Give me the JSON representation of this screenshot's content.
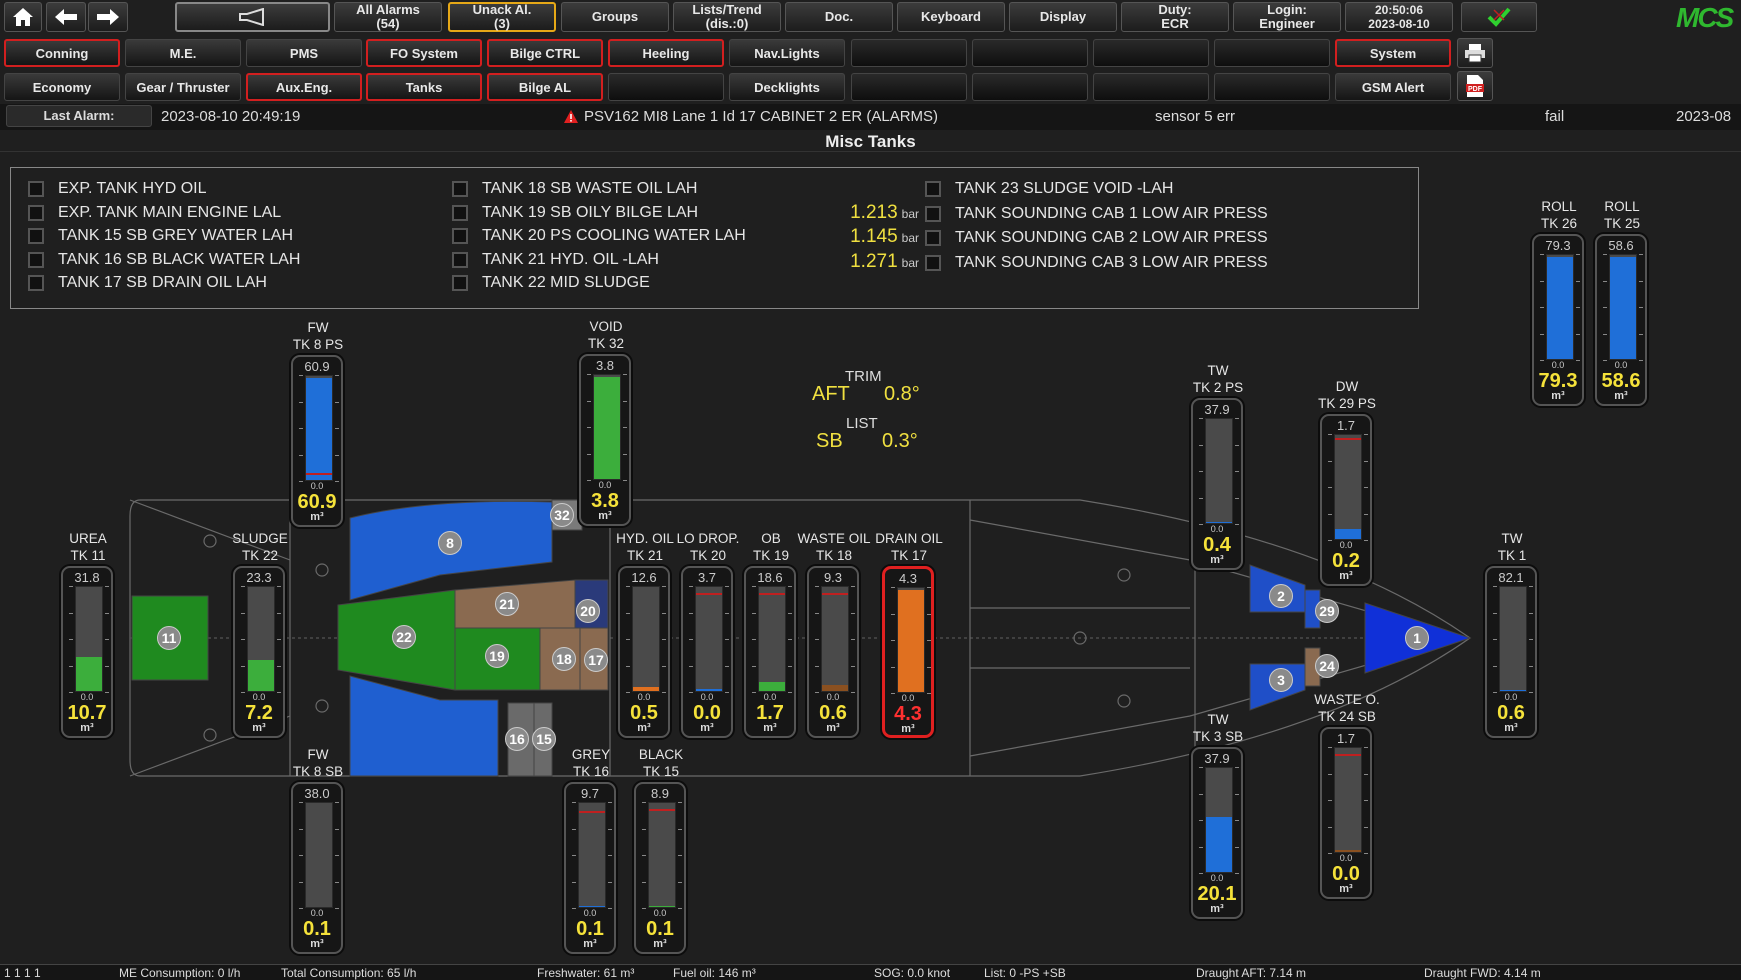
{
  "toolbar": {
    "all_alarms": [
      "All Alarms",
      "(54)"
    ],
    "unack": [
      "Unack Al.",
      "(3)"
    ],
    "groups": "Groups",
    "lists": [
      "Lists/Trend",
      "(dis.:0)"
    ],
    "doc": "Doc.",
    "keyboard": "Keyboard",
    "display": "Display",
    "duty": [
      "Duty:",
      "ECR"
    ],
    "login": [
      "Login:",
      "Engineer"
    ],
    "time": [
      "20:50:06",
      "2023-08-10"
    ],
    "logo": "MCS"
  },
  "nav_row1": [
    "Conning",
    "M.E.",
    "PMS",
    "FO System",
    "Bilge CTRL",
    "Heeling",
    "Nav.Lights",
    "",
    "",
    "",
    "",
    "System"
  ],
  "nav_row2": [
    "Economy",
    "Gear / Thruster",
    "Aux.Eng.",
    "Tanks",
    "Bilge AL",
    "",
    "Decklights",
    "",
    "",
    "",
    "",
    "GSM Alert"
  ],
  "alarm": {
    "label": "Last Alarm:",
    "time": "2023-08-10 20:49:19",
    "text": "PSV162 MI8 Lane  1 Id 17 CABINET 2 ER (ALARMS)",
    "desc": "sensor 5 err",
    "state": "fail",
    "date_cut": "2023-08"
  },
  "page_title": "Misc Tanks",
  "alarm_list_col1": [
    "EXP. TANK HYD OIL",
    "EXP. TANK MAIN ENGINE LAL",
    "TANK 15 SB GREY WATER LAH",
    "TANK 16 SB BLACK WATER LAH",
    "TANK 17 SB DRAIN OIL LAH"
  ],
  "alarm_list_col2": [
    "TANK 18 SB WASTE OIL LAH",
    "TANK 19 SB OILY BILGE LAH",
    "TANK 20 PS COOLING WATER LAH",
    "TANK 21 HYD. OIL -LAH",
    "TANK 22 MID SLUDGE"
  ],
  "alarm_list_col3": [
    {
      "value": "",
      "unit": "",
      "label": "TANK 23 SLUDGE VOID -LAH"
    },
    {
      "value": "1.213",
      "unit": "bar",
      "label": "TANK SOUNDING CAB 1 LOW AIR PRESS"
    },
    {
      "value": "1.145",
      "unit": "bar",
      "label": "TANK SOUNDING CAB 2 LOW AIR PRESS"
    },
    {
      "value": "1.271",
      "unit": "bar",
      "label": "TANK SOUNDING CAB 3 LOW AIR PRESS"
    }
  ],
  "trim": {
    "trim_label": "TRIM",
    "trim_dir": "AFT",
    "trim_val": "0.8°",
    "list_label": "LIST",
    "list_dir": "SB",
    "list_val": "0.3°"
  },
  "tanks": [
    {
      "name": [
        "FW",
        "TK 8 PS"
      ],
      "max": "60.9",
      "min": "0.0",
      "value": "60.9",
      "fraction": 0.98,
      "color": "#1f6fd8",
      "mark": 0.05
    },
    {
      "name": [
        "VOID",
        "TK 32"
      ],
      "max": "3.8",
      "min": "0.0",
      "value": "3.8",
      "fraction": 0.98,
      "color": "#3cae3c"
    },
    {
      "name": [
        "TW",
        "TK 2 PS"
      ],
      "max": "37.9",
      "min": "0.0",
      "value": "0.4",
      "fraction": 0.01,
      "color": "#1f6fd8"
    },
    {
      "name": [
        "DW",
        "TK 29 PS"
      ],
      "max": "1.7",
      "min": "0.0",
      "value": "0.2",
      "fraction": 0.1,
      "color": "#1f6fd8",
      "mark": 0.95
    },
    {
      "name": [
        "ROLL",
        "TK 26"
      ],
      "max": "79.3",
      "min": "0.0",
      "value": "79.3",
      "fraction": 0.98,
      "color": "#1f6fd8"
    },
    {
      "name": [
        "ROLL",
        "TK 25"
      ],
      "max": "58.6",
      "min": "0.0",
      "value": "58.6",
      "fraction": 0.98,
      "color": "#1f6fd8"
    },
    {
      "name": [
        "UREA",
        "TK 11"
      ],
      "max": "31.8",
      "min": "0.0",
      "value": "10.7",
      "fraction": 0.33,
      "color": "#3cae3c"
    },
    {
      "name": [
        "SLUDGE",
        "TK 22"
      ],
      "max": "23.3",
      "min": "0.0",
      "value": "7.2",
      "fraction": 0.3,
      "color": "#3cae3c"
    },
    {
      "name": [
        "HYD. OIL",
        "TK 21"
      ],
      "max": "12.6",
      "min": "0.0",
      "value": "0.5",
      "fraction": 0.04,
      "color": "#e07020"
    },
    {
      "name": [
        "LO DROP.",
        "TK 20"
      ],
      "max": "3.7",
      "min": "0.0",
      "value": "0.0",
      "fraction": 0.02,
      "color": "#1f6fd8",
      "mark": 0.92
    },
    {
      "name": [
        "OB",
        "TK 19"
      ],
      "max": "18.6",
      "min": "0.0",
      "value": "1.7",
      "fraction": 0.09,
      "color": "#3cae3c",
      "mark": 0.92
    },
    {
      "name": [
        "WASTE OIL",
        "TK 18"
      ],
      "max": "9.3",
      "min": "0.0",
      "value": "0.6",
      "fraction": 0.06,
      "color": "#8a5020",
      "mark": 0.92
    },
    {
      "name": [
        "DRAIN OIL",
        "TK 17"
      ],
      "max": "4.3",
      "min": "0.0",
      "value": "4.3",
      "fraction": 0.98,
      "color": "#e07020",
      "alarm": true
    },
    {
      "name": [
        "TW",
        "TK 1"
      ],
      "max": "82.1",
      "min": "0.0",
      "value": "0.6",
      "fraction": 0.01,
      "color": "#1f6fd8"
    },
    {
      "name": [
        "FW",
        "TK 8 SB"
      ],
      "max": "38.0",
      "min": "0.0",
      "value": "0.1",
      "fraction": 0.0,
      "color": "#1f6fd8"
    },
    {
      "name": [
        "GREY",
        "TK 16"
      ],
      "max": "9.7",
      "min": "0.0",
      "value": "0.1",
      "fraction": 0.01,
      "color": "#1f6fd8",
      "mark": 0.9
    },
    {
      "name": [
        "BLACK",
        "TK 15"
      ],
      "max": "8.9",
      "min": "0.0",
      "value": "0.1",
      "fraction": 0.01,
      "color": "#3cae3c",
      "mark": 0.92
    },
    {
      "name": [
        "TW",
        "TK 3 SB"
      ],
      "max": "37.9",
      "min": "0.0",
      "value": "20.1",
      "fraction": 0.53,
      "color": "#1f6fd8"
    },
    {
      "name": [
        "WASTE O.",
        "TK 24 SB"
      ],
      "max": "1.7",
      "min": "0.0",
      "value": "0.0",
      "fraction": 0.02,
      "color": "#8a5020",
      "mark": 0.92
    }
  ],
  "tank_unit": "m³",
  "hull_tanks": [
    "8",
    "32",
    "21",
    "20",
    "22",
    "19",
    "18",
    "17",
    "11",
    "16",
    "15",
    "2",
    "29",
    "3",
    "24",
    "1"
  ],
  "status": {
    "counts": "1  1  1  1",
    "me_cons": "ME Consumption:  0 l/h",
    "total_cons": "Total Consumption:  65 l/h",
    "freshwater": "Freshwater:  61 m³",
    "fuel": "Fuel oil:  146 m³",
    "sog": "SOG:  0.0 knot",
    "list": "List:  0   -PS  +SB",
    "draught_aft": "Draught AFT:  7.14 m",
    "draught_fwd": "Draught FWD:  4.14 m"
  },
  "colors": {
    "accent_red": "#d21f1f",
    "accent_yellow": "#e6a817",
    "value_yellow": "#f5e23a"
  }
}
